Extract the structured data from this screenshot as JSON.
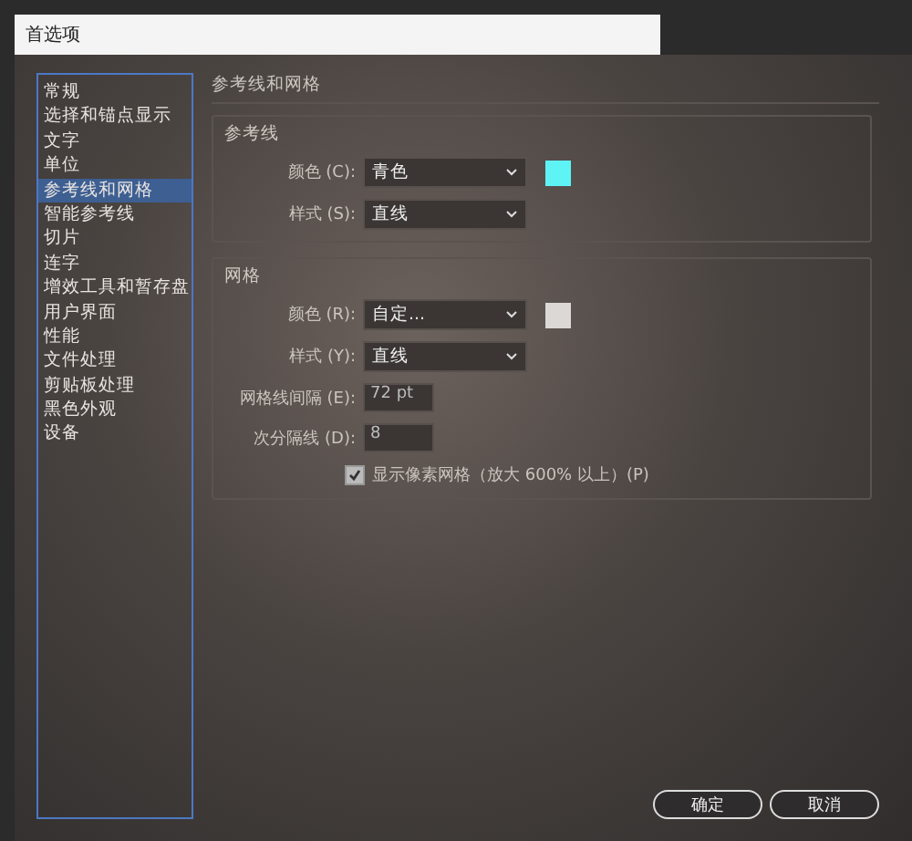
{
  "window": {
    "title": "首选项"
  },
  "sidebar": {
    "items": [
      {
        "label": "常规",
        "selected": false
      },
      {
        "label": "选择和锚点显示",
        "selected": false
      },
      {
        "label": "文字",
        "selected": false
      },
      {
        "label": "单位",
        "selected": false
      },
      {
        "label": "参考线和网格",
        "selected": true
      },
      {
        "label": "智能参考线",
        "selected": false
      },
      {
        "label": "切片",
        "selected": false
      },
      {
        "label": "连字",
        "selected": false
      },
      {
        "label": "增效工具和暂存盘",
        "selected": false
      },
      {
        "label": "用户界面",
        "selected": false
      },
      {
        "label": "性能",
        "selected": false
      },
      {
        "label": "文件处理",
        "selected": false
      },
      {
        "label": "剪贴板处理",
        "selected": false
      },
      {
        "label": "黑色外观",
        "selected": false
      },
      {
        "label": "设备",
        "selected": false
      }
    ]
  },
  "section_title": "参考线和网格",
  "guides": {
    "title": "参考线",
    "rows": [
      {
        "label": "颜色 (C):",
        "value": "青色",
        "color": "#5ef4f6"
      },
      {
        "label": "样式 (S):",
        "value": "直线"
      }
    ]
  },
  "grid": {
    "title": "网格",
    "rows": [
      {
        "label": "颜色 (R):",
        "value": "自定...",
        "color": "#dcd8d6"
      },
      {
        "label": "样式 (Y):",
        "value": "直线"
      }
    ],
    "fields": [
      {
        "label": "网格线间隔 (E):",
        "value": "72 pt"
      },
      {
        "label": "次分隔线 (D):",
        "value": "8"
      }
    ],
    "checkbox": {
      "label": "显示像素网格（放大 600% 以上）(P)",
      "checked": true
    }
  },
  "buttons": [
    {
      "label": "确定"
    },
    {
      "label": "取消"
    }
  ]
}
